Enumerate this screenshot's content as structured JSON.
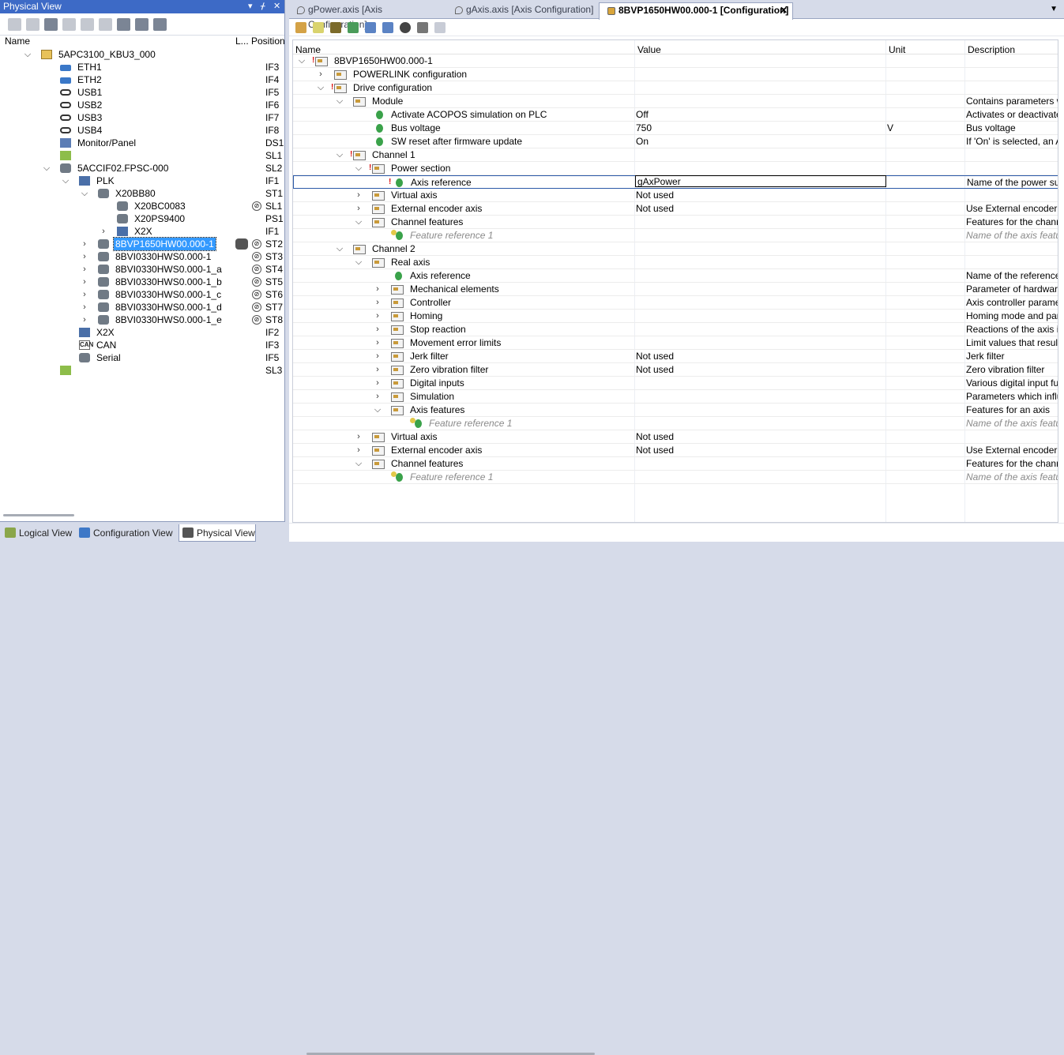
{
  "left_panel": {
    "title": "Physical View",
    "pin_glyph": "▾ ⊥ ✕",
    "columns": {
      "name": "Name",
      "l": "L...",
      "position": "Position"
    },
    "tree": [
      {
        "lv": 0,
        "exp": "open",
        "icon": "pc",
        "label": "5APC3100_KBU3_000",
        "pos": ""
      },
      {
        "lv": 1,
        "exp": "",
        "icon": "ent",
        "label": "ETH1",
        "pos": "IF3"
      },
      {
        "lv": 1,
        "exp": "",
        "icon": "ent",
        "label": "ETH2",
        "pos": "IF4"
      },
      {
        "lv": 1,
        "exp": "",
        "icon": "usb",
        "label": "USB1",
        "pos": "IF5"
      },
      {
        "lv": 1,
        "exp": "",
        "icon": "usb",
        "label": "USB2",
        "pos": "IF6"
      },
      {
        "lv": 1,
        "exp": "",
        "icon": "usb",
        "label": "USB3",
        "pos": "IF7"
      },
      {
        "lv": 1,
        "exp": "",
        "icon": "usb",
        "label": "USB4",
        "pos": "IF8"
      },
      {
        "lv": 1,
        "exp": "",
        "icon": "mon",
        "label": "Monitor/Panel",
        "pos": "DS1"
      },
      {
        "lv": 1,
        "exp": "",
        "icon": "grn",
        "label": "",
        "pos": "SL1"
      },
      {
        "lv": 1,
        "exp": "open",
        "icon": "dev",
        "label": "5ACCIF02.FPSC-000",
        "pos": "SL2"
      },
      {
        "lv": 2,
        "exp": "open",
        "icon": "plk",
        "label": "PLK",
        "pos": "IF1"
      },
      {
        "lv": 3,
        "exp": "open",
        "icon": "dev",
        "label": "X20BB80",
        "pos": "ST1"
      },
      {
        "lv": 4,
        "exp": "",
        "icon": "dev",
        "label": "X20BC0083",
        "pos": "SL1",
        "mark": true
      },
      {
        "lv": 4,
        "exp": "",
        "icon": "dev",
        "label": "X20PS9400",
        "pos": "PS1"
      },
      {
        "lv": 4,
        "exp": "closed",
        "icon": "plk",
        "label": "X2X",
        "pos": "IF1",
        "shift": true
      },
      {
        "lv": 3,
        "exp": "closed",
        "icon": "dev",
        "label": "8BVP1650HW00.000-1",
        "pos": "ST2",
        "mark": true,
        "sel": true,
        "ov": true
      },
      {
        "lv": 3,
        "exp": "closed",
        "icon": "dev",
        "label": "8BVI0330HWS0.000-1",
        "pos": "ST3",
        "mark": true
      },
      {
        "lv": 3,
        "exp": "closed",
        "icon": "dev",
        "label": "8BVI0330HWS0.000-1_a",
        "pos": "ST4",
        "mark": true
      },
      {
        "lv": 3,
        "exp": "closed",
        "icon": "dev",
        "label": "8BVI0330HWS0.000-1_b",
        "pos": "ST5",
        "mark": true
      },
      {
        "lv": 3,
        "exp": "closed",
        "icon": "dev",
        "label": "8BVI0330HWS0.000-1_c",
        "pos": "ST6",
        "mark": true
      },
      {
        "lv": 3,
        "exp": "closed",
        "icon": "dev",
        "label": "8BVI0330HWS0.000-1_d",
        "pos": "ST7",
        "mark": true
      },
      {
        "lv": 3,
        "exp": "closed",
        "icon": "dev",
        "label": "8BVI0330HWS0.000-1_e",
        "pos": "ST8",
        "mark": true
      },
      {
        "lv": 2,
        "exp": "",
        "icon": "plk",
        "label": "X2X",
        "pos": "IF2"
      },
      {
        "lv": 2,
        "exp": "",
        "icon": "can",
        "label": "CAN",
        "pos": "IF3"
      },
      {
        "lv": 2,
        "exp": "",
        "icon": "dev",
        "label": "Serial",
        "pos": "IF5"
      },
      {
        "lv": 1,
        "exp": "",
        "icon": "grn",
        "label": "",
        "pos": "SL3"
      }
    ],
    "bottom_tabs": [
      "Logical View",
      "Configuration View",
      "Physical View"
    ]
  },
  "tabs": [
    {
      "label": "gPower.axis [Axis Configuration]"
    },
    {
      "label": "gAxis.axis [Axis Configuration]"
    },
    {
      "label": "8BVP1650HW00.000-1 [Configuration]",
      "close": "✕"
    }
  ],
  "grid": {
    "columns": {
      "name": "Name",
      "value": "Value",
      "unit": "Unit",
      "description": "Description"
    },
    "rows": [
      {
        "lv": 0,
        "exp": "open",
        "icon": "folder",
        "err": true,
        "name": "8BVP1650HW00.000-1",
        "value": "",
        "unit": "",
        "desc": ""
      },
      {
        "lv": 1,
        "exp": "closed",
        "icon": "folder",
        "name": "POWERLINK configuration",
        "value": "",
        "unit": "",
        "desc": ""
      },
      {
        "lv": 1,
        "exp": "open",
        "icon": "folder",
        "err": true,
        "name": "Drive configuration",
        "value": "",
        "unit": "",
        "desc": ""
      },
      {
        "lv": 2,
        "exp": "open",
        "icon": "folder",
        "name": "Module",
        "value": "",
        "unit": "",
        "desc": "Contains parameters wh"
      },
      {
        "lv": 3,
        "exp": "",
        "icon": "gem",
        "name": "Activate ACOPOS simulation on PLC",
        "value": "Off",
        "unit": "",
        "desc": "Activates or deactivates"
      },
      {
        "lv": 3,
        "exp": "",
        "icon": "gem",
        "name": "Bus voltage",
        "value": "750",
        "unit": "V",
        "desc": "Bus voltage"
      },
      {
        "lv": 3,
        "exp": "",
        "icon": "gem",
        "name": "SW reset after firmware update",
        "value": "On",
        "unit": "",
        "desc": "If 'On' is selected, an AC"
      },
      {
        "lv": 2,
        "exp": "open",
        "icon": "folder",
        "err": true,
        "name": "Channel 1",
        "value": "",
        "unit": "",
        "desc": ""
      },
      {
        "lv": 3,
        "exp": "open",
        "icon": "folder",
        "err": true,
        "name": "Power section",
        "value": "",
        "unit": "",
        "desc": ""
      },
      {
        "lv": 4,
        "exp": "",
        "icon": "gem",
        "err": true,
        "name": "Axis reference",
        "value": "gAxPower",
        "unit": "",
        "desc": "Name of the power sup",
        "sel": true
      },
      {
        "lv": 3,
        "exp": "closed",
        "icon": "folder",
        "name": "Virtual axis",
        "value": "Not used",
        "unit": "",
        "desc": ""
      },
      {
        "lv": 3,
        "exp": "closed",
        "icon": "folder",
        "name": "External encoder axis",
        "value": "Not used",
        "unit": "",
        "desc": "Use External encoder a"
      },
      {
        "lv": 3,
        "exp": "open",
        "icon": "folder",
        "name": "Channel features",
        "value": "",
        "unit": "",
        "desc": "Features for the channe"
      },
      {
        "lv": 4,
        "exp": "",
        "icon": "star",
        "name": "Feature reference 1",
        "value": "",
        "unit": "",
        "desc": "Name of the axis featur",
        "italic": true
      },
      {
        "lv": 2,
        "exp": "open",
        "icon": "folder",
        "name": "Channel 2",
        "value": "",
        "unit": "",
        "desc": ""
      },
      {
        "lv": 3,
        "exp": "open",
        "icon": "folder",
        "name": "Real axis",
        "value": "",
        "unit": "",
        "desc": ""
      },
      {
        "lv": 4,
        "exp": "",
        "icon": "gem",
        "name": "Axis reference",
        "value": "",
        "unit": "",
        "desc": "Name of the referenced"
      },
      {
        "lv": 4,
        "exp": "closed",
        "icon": "folder",
        "name": "Mechanical elements",
        "value": "",
        "unit": "",
        "desc": "Parameter of hardware e"
      },
      {
        "lv": 4,
        "exp": "closed",
        "icon": "folder",
        "name": "Controller",
        "value": "",
        "unit": "",
        "desc": "Axis controller paramete"
      },
      {
        "lv": 4,
        "exp": "closed",
        "icon": "folder",
        "name": "Homing",
        "value": "",
        "unit": "",
        "desc": "Homing mode and paran"
      },
      {
        "lv": 4,
        "exp": "closed",
        "icon": "folder",
        "name": "Stop reaction",
        "value": "",
        "unit": "",
        "desc": "Reactions of the axis in"
      },
      {
        "lv": 4,
        "exp": "closed",
        "icon": "folder",
        "name": "Movement error limits",
        "value": "",
        "unit": "",
        "desc": "Limit values that result in"
      },
      {
        "lv": 4,
        "exp": "closed",
        "icon": "folder",
        "name": "Jerk filter",
        "value": "Not used",
        "unit": "",
        "desc": "Jerk filter"
      },
      {
        "lv": 4,
        "exp": "closed",
        "icon": "folder",
        "name": "Zero vibration filter",
        "value": "Not used",
        "unit": "",
        "desc": "Zero vibration filter"
      },
      {
        "lv": 4,
        "exp": "closed",
        "icon": "folder",
        "name": "Digital inputs",
        "value": "",
        "unit": "",
        "desc": "Various digital input func"
      },
      {
        "lv": 4,
        "exp": "closed",
        "icon": "folder",
        "name": "Simulation",
        "value": "",
        "unit": "",
        "desc": "Parameters which influe"
      },
      {
        "lv": 4,
        "exp": "open",
        "icon": "folder",
        "name": "Axis features",
        "value": "",
        "unit": "",
        "desc": "Features for an axis"
      },
      {
        "lv": 5,
        "exp": "",
        "icon": "star",
        "name": "Feature reference 1",
        "value": "",
        "unit": "",
        "desc": "Name of the axis featur",
        "italic": true
      },
      {
        "lv": 3,
        "exp": "closed",
        "icon": "folder",
        "name": "Virtual axis",
        "value": "Not used",
        "unit": "",
        "desc": ""
      },
      {
        "lv": 3,
        "exp": "closed",
        "icon": "folder",
        "name": "External encoder axis",
        "value": "Not used",
        "unit": "",
        "desc": "Use External encoder a"
      },
      {
        "lv": 3,
        "exp": "open",
        "icon": "folder",
        "name": "Channel features",
        "value": "",
        "unit": "",
        "desc": "Features for the channe"
      },
      {
        "lv": 4,
        "exp": "",
        "icon": "star",
        "name": "Feature reference 1",
        "value": "",
        "unit": "",
        "desc": "Name of the axis featur",
        "italic": true
      }
    ]
  },
  "glyphs": {
    "open": "⌵",
    "closed": "›",
    "mark": "⊘",
    "tab_dropdown": "▼"
  }
}
